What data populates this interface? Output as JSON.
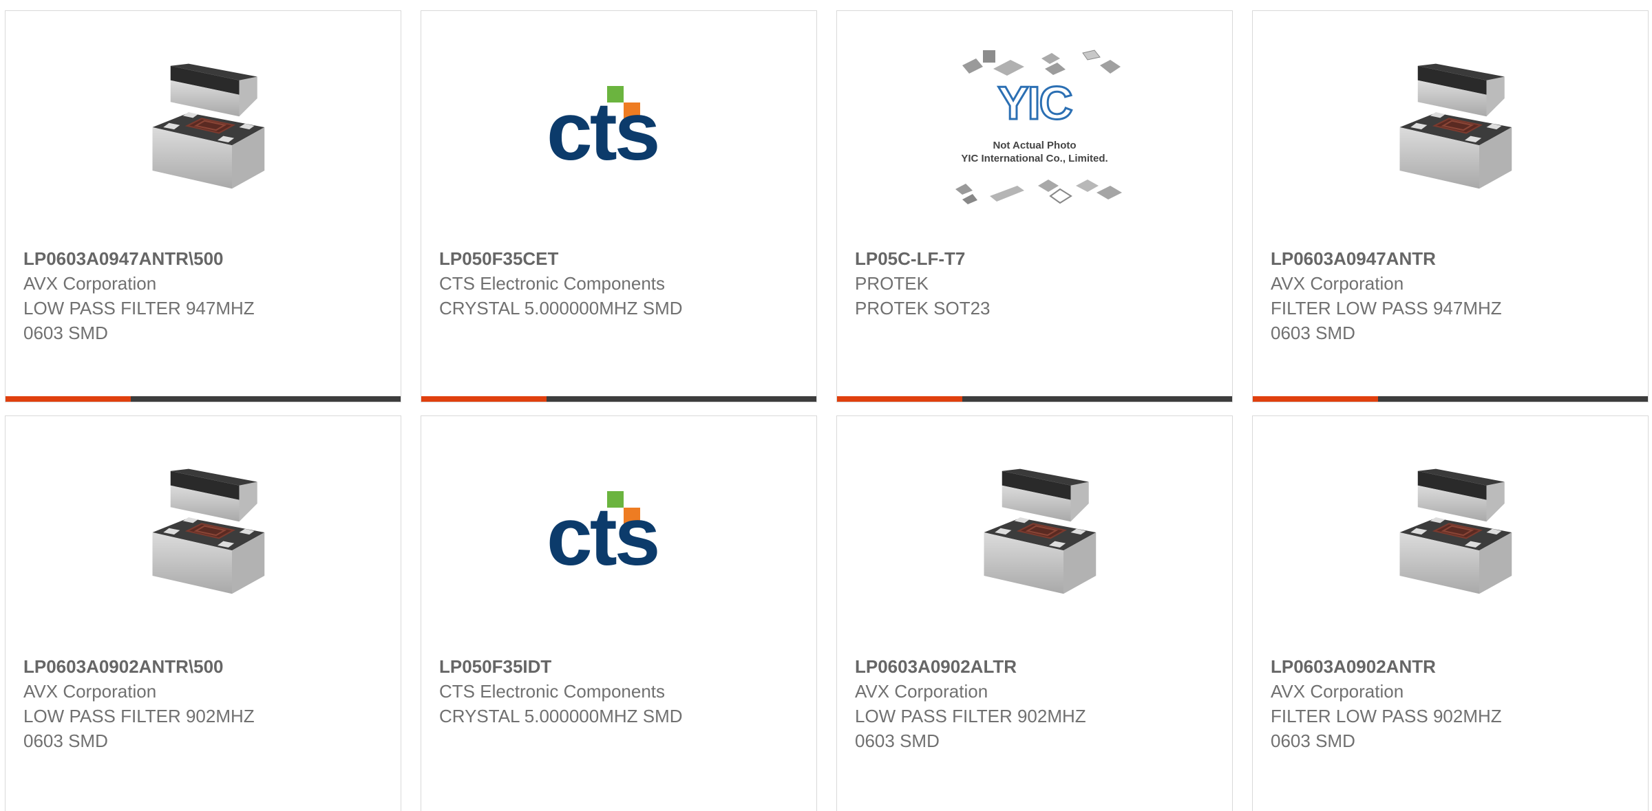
{
  "colors": {
    "accent": "#e0400e",
    "bar": "#3d3d3d",
    "cts_blue": "#0c3b6b",
    "cts_green": "#6bb43f",
    "cts_orange": "#ee7c22"
  },
  "products": [
    {
      "part_number": "LP0603A0947ANTR\\500",
      "manufacturer": "AVX Corporation",
      "description": "LOW PASS FILTER 947MHZ\n0603 SMD",
      "image": "smd-filter-icon"
    },
    {
      "part_number": "LP050F35CET",
      "manufacturer": "CTS Electronic Components",
      "description": "CRYSTAL 5.000000MHZ SMD",
      "image": "cts-logo"
    },
    {
      "part_number": "LP05C-LF-T7",
      "manufacturer": "PROTEK",
      "description": "PROTEK SOT23",
      "image": "yic-placeholder"
    },
    {
      "part_number": "LP0603A0947ANTR",
      "manufacturer": "AVX Corporation",
      "description": "FILTER LOW PASS 947MHZ\n0603 SMD",
      "image": "smd-filter-icon"
    },
    {
      "part_number": "LP0603A0902ANTR\\500",
      "manufacturer": "AVX Corporation",
      "description": "LOW PASS FILTER 902MHZ\n0603 SMD",
      "image": "smd-filter-icon"
    },
    {
      "part_number": "LP050F35IDT",
      "manufacturer": "CTS Electronic Components",
      "description": "CRYSTAL 5.000000MHZ SMD",
      "image": "cts-logo"
    },
    {
      "part_number": "LP0603A0902ALTR",
      "manufacturer": "AVX Corporation",
      "description": "LOW PASS FILTER 902MHZ\n0603 SMD",
      "image": "smd-filter-icon"
    },
    {
      "part_number": "LP0603A0902ANTR",
      "manufacturer": "AVX Corporation",
      "description": "FILTER LOW PASS 902MHZ\n0603 SMD",
      "image": "smd-filter-icon"
    }
  ],
  "cts_logo": {
    "text": "cts"
  },
  "yic_placeholder": {
    "brand": "YIC",
    "line1": "Not Actual Photo",
    "line2": "YIC International Co., Limited."
  }
}
